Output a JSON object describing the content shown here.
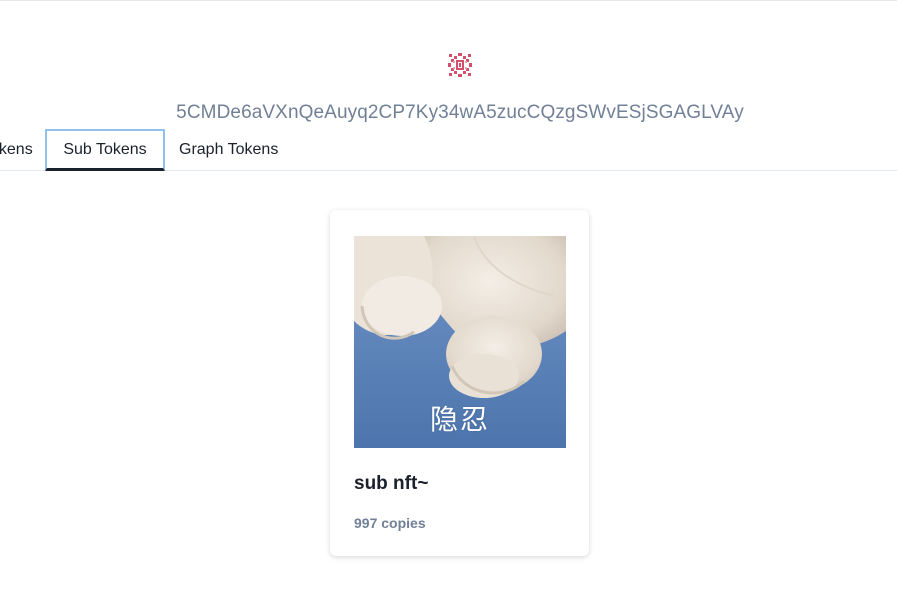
{
  "account": {
    "identicon": "identicon-icon",
    "identicon_color": "#d4506a",
    "address": "5CMDe6aVXnQeAuyq2CP7Ky34wA5zucCQzgSWvESjSGAGLVAy"
  },
  "tabs": [
    {
      "label": "Tokens"
    },
    {
      "label": "Sub Tokens",
      "active": true
    },
    {
      "label": "Graph Tokens"
    }
  ],
  "nft": {
    "image_caption": "隐忍",
    "title": "sub nft~",
    "copies": "997 copies"
  }
}
